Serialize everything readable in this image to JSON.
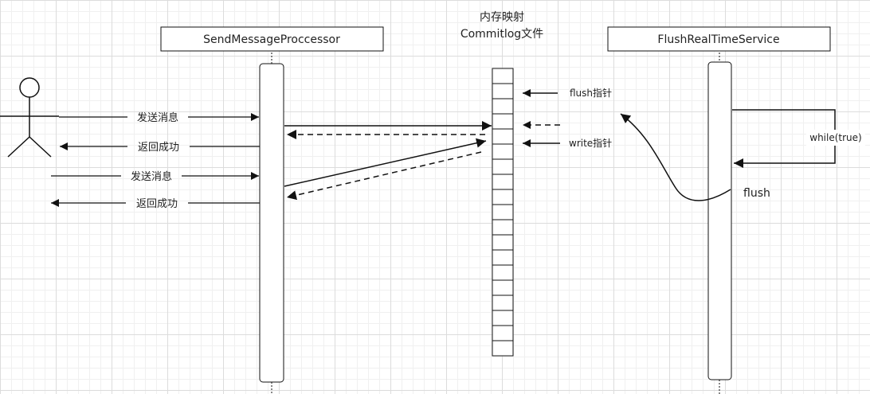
{
  "participants": {
    "sender": "SendMessageProccessor",
    "mapped_title_line1": "内存映射",
    "mapped_title_line2": "Commitlog文件",
    "flush_service": "FlushRealTimeService"
  },
  "messages": {
    "send_1": "发送消息",
    "return_1": "返回成功",
    "send_2": "发送消息",
    "return_2": "返回成功"
  },
  "pointers": {
    "flush": "flush指针",
    "write": "write指针"
  },
  "loop": {
    "label": "while(true)",
    "flush_label": "flush"
  }
}
